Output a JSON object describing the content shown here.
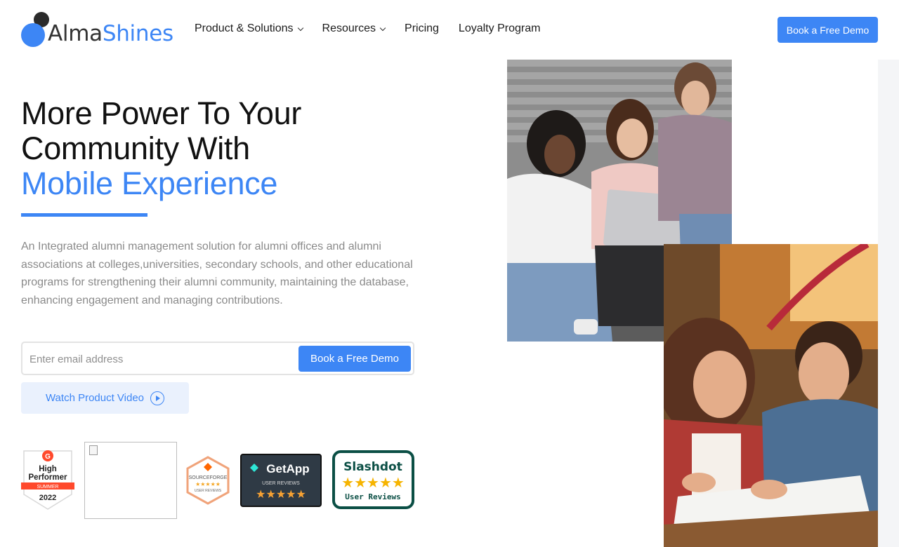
{
  "brand": {
    "name_part1": "Alma",
    "name_part2": "Shines",
    "primary_color": "#3d86f5",
    "dark_color": "#2b2b2b"
  },
  "nav": {
    "items": [
      {
        "label": "Product & Solutions",
        "has_dropdown": true
      },
      {
        "label": "Resources",
        "has_dropdown": true
      },
      {
        "label": "Pricing",
        "has_dropdown": false
      },
      {
        "label": "Loyalty Program",
        "has_dropdown": false
      }
    ],
    "cta_label": "Book a Free Demo"
  },
  "hero": {
    "title_line1": "More Power To Your",
    "title_line2": "Community With",
    "title_accent": "Mobile Experience",
    "description": "An Integrated alumni management solution for alumni offices and alumni associations at colleges,universities, secondary schools, and other educational programs for strengthening their alumni community, maintaining the database, enhancing engagement and managing contributions.",
    "email_placeholder": "Enter email address",
    "form_cta_label": "Book a Free Demo",
    "watch_video_label": "Watch Product Video"
  },
  "badges": {
    "g2": {
      "line1": "High",
      "line2": "Performer",
      "season": "SUMMER",
      "year": "2022"
    },
    "sourceforge": {
      "brand": "SOURCEFORGE",
      "sub": "USER REVIEWS",
      "stars": 5
    },
    "getapp": {
      "brand": "GetApp",
      "sub": "USER REVIEWS",
      "stars": 4.5
    },
    "slashdot": {
      "brand": "Slashdot",
      "sub": "User Reviews",
      "stars": 5
    }
  }
}
